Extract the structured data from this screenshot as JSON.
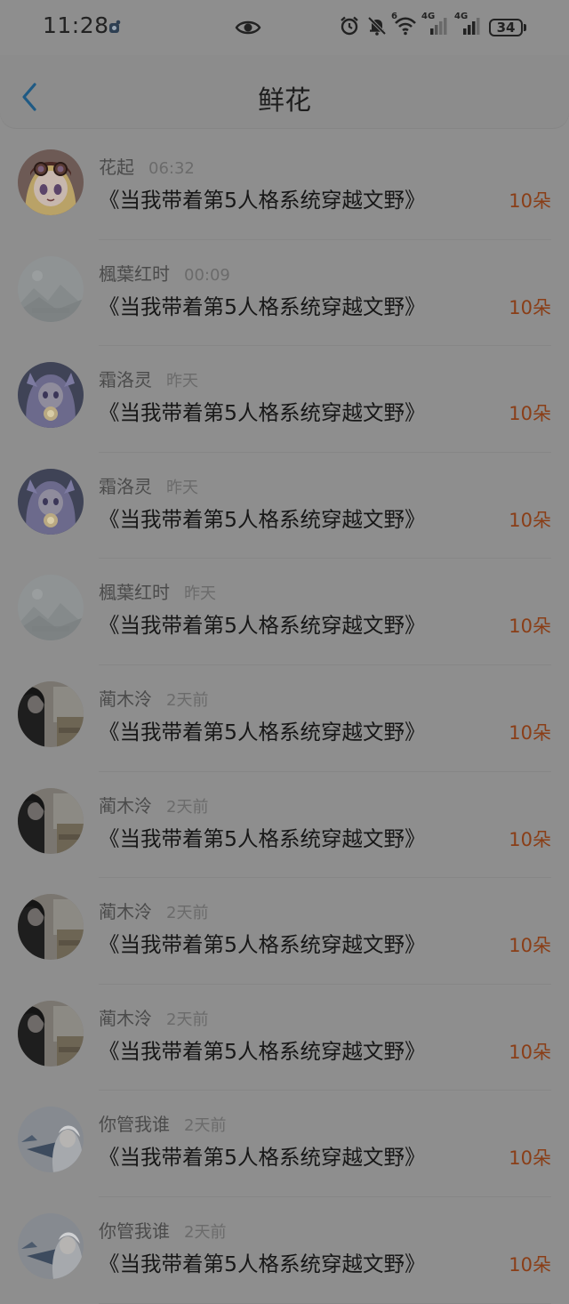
{
  "status_bar": {
    "time": "11:28",
    "battery": "34",
    "network_labels": [
      "6",
      "4G",
      "4G"
    ],
    "icons": [
      "app-notification-icon",
      "eye-icon",
      "alarm-icon",
      "mute-icon",
      "wifi-icon",
      "signal-4g-icon",
      "signal-4g-icon",
      "battery-icon"
    ]
  },
  "header": {
    "title": "鲜花",
    "back_icon": "chevron-left-icon",
    "accent_color": "#1f5a84"
  },
  "colors": {
    "flower_count": "#8a3e17",
    "background": "#8e8e8e"
  },
  "list": [
    {
      "name": "花起",
      "time": "06:32",
      "book": "《当我带着第5人格系统穿越文野》",
      "count": "10朵",
      "avatar": "anime-girl-goggles"
    },
    {
      "name": "楓葉红时",
      "time": "00:09",
      "book": "《当我带着第5人格系统穿越文野》",
      "count": "10朵",
      "avatar": "placeholder-landscape"
    },
    {
      "name": "霜洛灵",
      "time": "昨天",
      "book": "《当我带着第5人格系统穿越文野》",
      "count": "10朵",
      "avatar": "anime-girl-glow"
    },
    {
      "name": "霜洛灵",
      "time": "昨天",
      "book": "《当我带着第5人格系统穿越文野》",
      "count": "10朵",
      "avatar": "anime-girl-glow"
    },
    {
      "name": "楓葉红时",
      "time": "昨天",
      "book": "《当我带着第5人格系统穿越文野》",
      "count": "10朵",
      "avatar": "placeholder-landscape"
    },
    {
      "name": "蔺木泠",
      "time": "2天前",
      "book": "《当我带着第5人格系统穿越文野》",
      "count": "10朵",
      "avatar": "dark-hair-room"
    },
    {
      "name": "蔺木泠",
      "time": "2天前",
      "book": "《当我带着第5人格系统穿越文野》",
      "count": "10朵",
      "avatar": "dark-hair-room"
    },
    {
      "name": "蔺木泠",
      "time": "2天前",
      "book": "《当我带着第5人格系统穿越文野》",
      "count": "10朵",
      "avatar": "dark-hair-room"
    },
    {
      "name": "蔺木泠",
      "time": "2天前",
      "book": "《当我带着第5人格系统穿越文野》",
      "count": "10朵",
      "avatar": "dark-hair-room"
    },
    {
      "name": "你管我谁",
      "time": "2天前",
      "book": "《当我带着第5人格系统穿越文野》",
      "count": "10朵",
      "avatar": "white-hair-figure"
    },
    {
      "name": "你管我谁",
      "time": "2天前",
      "book": "《当我带着第5人格系统穿越文野》",
      "count": "10朵",
      "avatar": "white-hair-figure"
    }
  ]
}
